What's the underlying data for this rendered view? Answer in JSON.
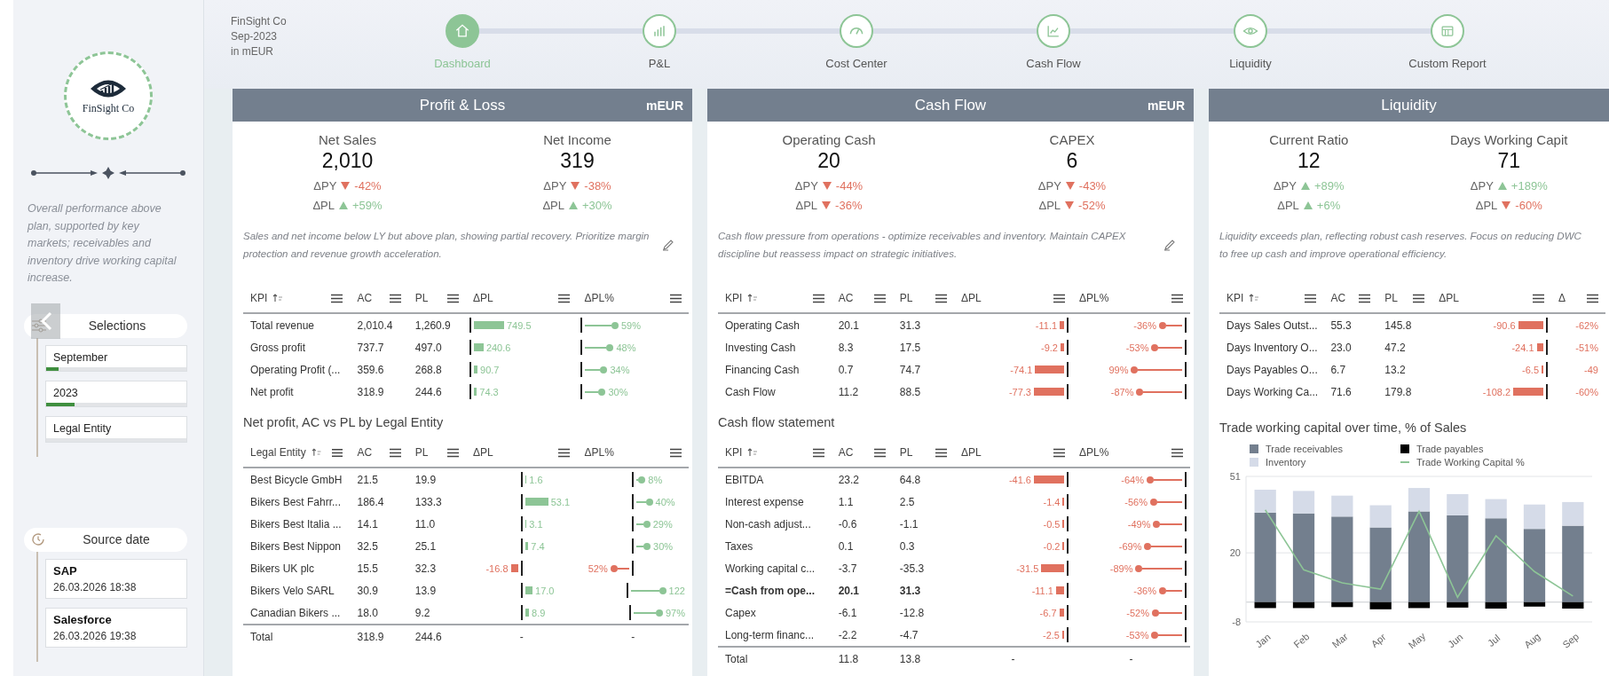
{
  "header": {
    "company": "FinSight Co",
    "period": "Sep-2023",
    "unit": "in mEUR"
  },
  "steps": [
    {
      "label": "Dashboard",
      "selected": true
    },
    {
      "label": "P&L",
      "selected": false
    },
    {
      "label": "Cost Center",
      "selected": false
    },
    {
      "label": "Cash Flow",
      "selected": false
    },
    {
      "label": "Liquidity",
      "selected": false
    },
    {
      "label": "Custom Report",
      "selected": false
    }
  ],
  "sidebar": {
    "logo": "FinSight Co",
    "summary": "Overall performance above plan, supported by key markets; receivables and inventory drive working capital increase.",
    "selections": {
      "title": "Selections",
      "items": [
        {
          "label": "September",
          "level": 0.09
        },
        {
          "label": "2023",
          "level": 0.2
        },
        {
          "label": "Legal Entity"
        }
      ]
    },
    "source_date": {
      "title": "Source date",
      "items": [
        {
          "system": "SAP",
          "timestamp": "26.03.2026 18:38"
        },
        {
          "system": "Salesforce",
          "timestamp": "26.03.2026 19:38"
        }
      ]
    }
  },
  "panels": [
    {
      "title": "Profit & Loss",
      "unit": "mEUR",
      "editable": true,
      "kpis": [
        {
          "label": "Net Sales",
          "value": "2,010",
          "deltas": [
            {
              "label": "ΔPY",
              "negative": true,
              "value": "-42%"
            },
            {
              "label": "ΔPL",
              "negative": false,
              "value": "+59%"
            }
          ]
        },
        {
          "label": "Net Income",
          "value": "319",
          "deltas": [
            {
              "label": "ΔPY",
              "negative": true,
              "value": "-38%"
            },
            {
              "label": "ΔPL",
              "negative": false,
              "value": "+30%"
            }
          ]
        }
      ],
      "comment": "Sales and net income below LY but above plan, showing partial recovery. Prioritize margin protection and revenue growth acceleration.",
      "tables": [
        {
          "columns": [
            "KPI",
            "AC",
            "PL",
            "ΔPL",
            "ΔPL%"
          ],
          "pct_bars": true,
          "rows": [
            {
              "cells": [
                "Total revenue",
                "2,010.4",
                "1,260.9"
              ],
              "delta": {
                "value": "749.5",
                "negative": false
              },
              "delta_pct": {
                "value": "59%",
                "negative": false
              }
            },
            {
              "cells": [
                "Gross profit",
                "737.7",
                "497.0"
              ],
              "delta": {
                "value": "240.6",
                "negative": false
              },
              "delta_pct": {
                "value": "48%",
                "negative": false
              }
            },
            {
              "cells": [
                "Operating Profit (...",
                "359.6",
                "268.8"
              ],
              "delta": {
                "value": "90.7",
                "negative": false
              },
              "delta_pct": {
                "value": "34%",
                "negative": false
              }
            },
            {
              "cells": [
                "Net profit",
                "318.9",
                "244.6"
              ],
              "delta": {
                "value": "74.3",
                "negative": false
              },
              "delta_pct": {
                "value": "30%",
                "negative": false
              }
            }
          ]
        },
        {
          "title": "Net profit, AC vs PL by Legal Entity",
          "columns": [
            "Legal Entity",
            "AC",
            "PL",
            "ΔPL",
            "ΔPL%"
          ],
          "pct_bars": true,
          "rows": [
            {
              "cells": [
                "Best Bicycle GmbH",
                "21.5",
                "19.9"
              ],
              "delta": {
                "value": "1.6",
                "negative": false
              },
              "delta_pct": {
                "value": "8%",
                "negative": false
              }
            },
            {
              "cells": [
                "Bikers Best Fahrr...",
                "186.4",
                "133.3"
              ],
              "delta": {
                "value": "53.1",
                "negative": false
              },
              "delta_pct": {
                "value": "40%",
                "negative": false
              }
            },
            {
              "cells": [
                "Bikers Best Italia ...",
                "14.1",
                "11.0"
              ],
              "delta": {
                "value": "3.1",
                "negative": false
              },
              "delta_pct": {
                "value": "29%",
                "negative": false
              }
            },
            {
              "cells": [
                "Bikers Best Nippon",
                "32.5",
                "25.1"
              ],
              "delta": {
                "value": "7.4",
                "negative": false
              },
              "delta_pct": {
                "value": "30%",
                "negative": false
              }
            },
            {
              "cells": [
                "Bikers UK plc",
                "15.5",
                "32.3"
              ],
              "delta": {
                "value": "-16.8",
                "negative": true
              },
              "delta_pct": {
                "value": "52%",
                "negative": true
              }
            },
            {
              "cells": [
                "Bikers Velo SARL",
                "30.9",
                "13.9"
              ],
              "delta": {
                "value": "17.0",
                "negative": false
              },
              "delta_pct": {
                "value": "122",
                "negative": false
              }
            },
            {
              "cells": [
                "Canadian Bikers ...",
                "18.0",
                "9.2"
              ],
              "delta": {
                "value": "8.9",
                "negative": false
              },
              "delta_pct": {
                "value": "97%",
                "negative": false
              }
            }
          ],
          "total": [
            "Total",
            "318.9",
            "244.6",
            "-",
            "-"
          ]
        }
      ]
    },
    {
      "title": "Cash Flow",
      "unit": "mEUR",
      "editable": true,
      "kpis": [
        {
          "label": "Operating Cash",
          "value": "20",
          "deltas": [
            {
              "label": "ΔPY",
              "negative": true,
              "value": "-44%"
            },
            {
              "label": "ΔPL",
              "negative": true,
              "value": "-36%"
            }
          ]
        },
        {
          "label": "CAPEX",
          "value": "6",
          "deltas": [
            {
              "label": "ΔPY",
              "negative": true,
              "value": "-43%"
            },
            {
              "label": "ΔPL",
              "negative": true,
              "value": "-52%"
            }
          ]
        }
      ],
      "comment": "Cash flow pressure from operations - optimize receivables and inventory. Maintain CAPEX discipline but reassess impact on strategic initiatives.",
      "tables": [
        {
          "columns": [
            "KPI",
            "AC",
            "PL",
            "ΔPL",
            "ΔPL%"
          ],
          "pct_bars": true,
          "rows": [
            {
              "cells": [
                "Operating Cash",
                "20.1",
                "31.3"
              ],
              "delta": {
                "value": "-11.1",
                "negative": true
              },
              "delta_pct": {
                "value": "-36%",
                "negative": true
              }
            },
            {
              "cells": [
                "Investing Cash",
                "8.3",
                "17.5"
              ],
              "delta": {
                "value": "-9.2",
                "negative": true
              },
              "delta_pct": {
                "value": "-53%",
                "negative": true
              }
            },
            {
              "cells": [
                "Financing Cash",
                "0.7",
                "74.7"
              ],
              "delta": {
                "value": "-74.1",
                "negative": true
              },
              "delta_pct": {
                "value": "99%",
                "negative": true
              }
            },
            {
              "cells": [
                "Cash Flow",
                "11.2",
                "88.5"
              ],
              "delta": {
                "value": "-77.3",
                "negative": true
              },
              "delta_pct": {
                "value": "-87%",
                "negative": true
              }
            }
          ]
        },
        {
          "title": "Cash flow statement",
          "columns": [
            "KPI",
            "AC",
            "PL",
            "ΔPL",
            "ΔPL%"
          ],
          "pct_bars": true,
          "rows": [
            {
              "cells": [
                "EBITDA",
                "23.2",
                "64.8"
              ],
              "delta": {
                "value": "-41.6",
                "negative": true
              },
              "delta_pct": {
                "value": "-64%",
                "negative": true
              }
            },
            {
              "cells": [
                "Interest expense",
                "1.1",
                "2.5"
              ],
              "delta": {
                "value": "-1.4",
                "negative": true
              },
              "delta_pct": {
                "value": "-56%",
                "negative": true
              }
            },
            {
              "cells": [
                "Non-cash adjust...",
                "-0.6",
                "-1.1"
              ],
              "delta": {
                "value": "-0.5",
                "negative": true
              },
              "delta_pct": {
                "value": "-49%",
                "negative": true
              }
            },
            {
              "cells": [
                "Taxes",
                "0.1",
                "0.3"
              ],
              "delta": {
                "value": "-0.2",
                "negative": true
              },
              "delta_pct": {
                "value": "-69%",
                "negative": true
              }
            },
            {
              "cells": [
                "Working capital c...",
                "-3.7",
                "-35.3"
              ],
              "delta": {
                "value": "-31.5",
                "negative": true
              },
              "delta_pct": {
                "value": "-89%",
                "negative": true
              }
            },
            {
              "cells": [
                "=Cash from ope...",
                "20.1",
                "31.3"
              ],
              "bold": true,
              "delta": {
                "value": "-11.1",
                "negative": true
              },
              "delta_pct": {
                "value": "-36%",
                "negative": true
              }
            },
            {
              "cells": [
                "Capex",
                "-6.1",
                "-12.8"
              ],
              "delta": {
                "value": "-6.7",
                "negative": true
              },
              "delta_pct": {
                "value": "-52%",
                "negative": true
              }
            },
            {
              "cells": [
                "Long-term financ...",
                "-2.2",
                "-4.7"
              ],
              "delta": {
                "value": "-2.5",
                "negative": true
              },
              "delta_pct": {
                "value": "-53%",
                "negative": true
              }
            }
          ],
          "total": [
            "Total",
            "11.8",
            "13.8",
            "-",
            "-"
          ]
        }
      ]
    },
    {
      "title": "Liquidity",
      "editable": false,
      "kpis": [
        {
          "label": "Current Ratio",
          "value": "12",
          "deltas": [
            {
              "label": "ΔPY",
              "negative": false,
              "value": "+89%"
            },
            {
              "label": "ΔPL",
              "negative": false,
              "value": "+6%"
            }
          ]
        },
        {
          "label": "Days Working Capit",
          "value": "71",
          "deltas": [
            {
              "label": "ΔPY",
              "negative": false,
              "value": "+189%"
            },
            {
              "label": "ΔPL",
              "negative": true,
              "value": "-60%"
            }
          ]
        }
      ],
      "comment": "Liquidity exceeds plan, reflecting robust cash reserves. Focus on reducing DWC to free up cash and improve operational efficiency.",
      "tables": [
        {
          "columns": [
            "KPI",
            "AC",
            "PL",
            "ΔPL",
            "Δ"
          ],
          "pct_bars": false,
          "rows": [
            {
              "cells": [
                "Days Sales Outst...",
                "55.3",
                "145.8"
              ],
              "delta": {
                "value": "-90.6",
                "negative": true
              },
              "delta_pct": {
                "value": "-62%",
                "negative": true
              }
            },
            {
              "cells": [
                "Days Inventory O...",
                "23.0",
                "47.2"
              ],
              "delta": {
                "value": "-24.1",
                "negative": true
              },
              "delta_pct": {
                "value": "-51%",
                "negative": true
              }
            },
            {
              "cells": [
                "Days Payables O...",
                "6.7",
                "13.2"
              ],
              "delta": {
                "value": "-6.5",
                "negative": true
              },
              "delta_pct": {
                "value": "-49",
                "negative": true
              }
            },
            {
              "cells": [
                "Days Working Ca...",
                "71.6",
                "179.8"
              ],
              "delta": {
                "value": "-108.2",
                "negative": true
              },
              "delta_pct": {
                "value": "-60%",
                "negative": true
              }
            }
          ]
        }
      ],
      "chart_data": {
        "type": "bar",
        "title": "Trade working capital over time, % of Sales",
        "stacked": true,
        "categories": [
          "Jan",
          "Feb",
          "Mar",
          "Apr",
          "May",
          "Jun",
          "Jul",
          "Aug",
          "Sep"
        ],
        "ylim": [
          -8,
          51
        ],
        "yticks": [
          51,
          20,
          -8
        ],
        "legend": "top",
        "series": [
          {
            "name": "Trade receivables",
            "type": "bar",
            "color": "#737f8e",
            "values": [
              36.3,
              36.0,
              34.7,
              30.3,
              36.8,
              35.2,
              34.0,
              29.7,
              31.0
            ]
          },
          {
            "name": "Trade payables",
            "type": "bar",
            "color": "#000000",
            "values": [
              -2.4,
              -2.4,
              -2.0,
              -2.9,
              -2.4,
              -2.2,
              -2.6,
              -1.8,
              -2.6
            ]
          },
          {
            "name": "Inventory",
            "type": "bar",
            "color": "#d5dbe8",
            "values": [
              9.3,
              9.1,
              8.5,
              9.0,
              9.5,
              8.6,
              7.8,
              9.9,
              9.6
            ]
          },
          {
            "name": "Trade Working Capital %",
            "type": "line",
            "color": "#8dc596",
            "values": [
              37.4,
              13.1,
              7.8,
              5.3,
              36.8,
              2.0,
              26.9,
              12.4,
              2.5
            ]
          }
        ]
      }
    }
  ]
}
